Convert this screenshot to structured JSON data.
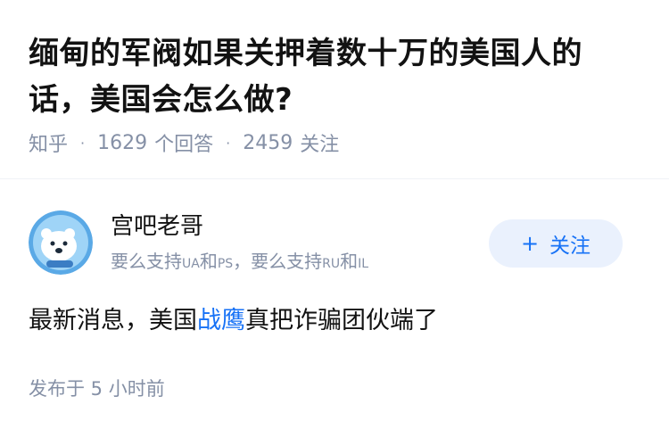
{
  "question": {
    "title": "缅甸的军阀如果关押着数十万的美国人的话，美国会怎么做?",
    "source": "知乎",
    "answer_count": "1629",
    "answer_label": "个回答",
    "follower_count": "2459",
    "follower_label": "关注"
  },
  "author": {
    "name": "宫吧老哥",
    "bio_part1": "要么支持",
    "bio_ua": "UA",
    "bio_and1": "和",
    "bio_ps": "PS",
    "bio_part2": "，要么支持",
    "bio_ru": "RU",
    "bio_and2": "和",
    "bio_il": "IL",
    "follow_label": "关注",
    "follow_icon": "+"
  },
  "answer": {
    "text_before": "最新消息，美国",
    "link_text": "战鹰",
    "text_after": "真把诈骗团伙端了",
    "time": "发布于 5 小时前"
  },
  "colors": {
    "accent": "#1772f6",
    "meta": "#8590a6",
    "text": "#121212"
  }
}
